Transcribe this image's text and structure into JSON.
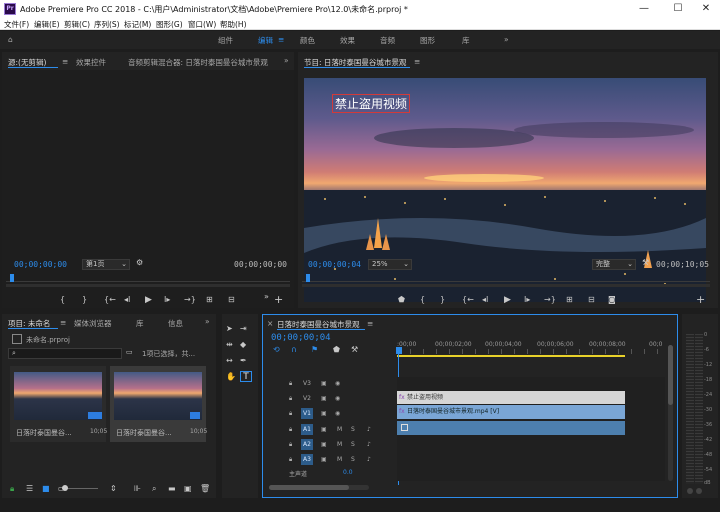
{
  "app": {
    "window_title": "Adobe Premiere Pro CC 2018 - C:\\用户\\Administrator\\文档\\Adobe\\Premiere Pro\\12.0\\未命名.prproj *",
    "logo_text": "Pr",
    "win_minimize": "—",
    "win_maximize": "☐",
    "win_close": "✕"
  },
  "menu": [
    "文件(F)",
    "编辑(E)",
    "剪辑(C)",
    "序列(S)",
    "标记(M)",
    "图形(G)",
    "窗口(W)",
    "帮助(H)"
  ],
  "workspace": {
    "tabs": [
      "组件",
      "编辑",
      "颜色",
      "效果",
      "音频",
      "图形",
      "库"
    ],
    "active": "编辑",
    "menu_glyph": "≡",
    "more_glyph": "»"
  },
  "source_panel": {
    "tabs": [
      "源:(无剪辑)",
      "效果控件",
      "音频剪辑混合器: 日落时泰国曼谷城市景观"
    ],
    "timecode_left": "00;00;00;00",
    "page_select": "第1页",
    "timecode_right": "00;00;00;00"
  },
  "program_panel": {
    "title": "节目: 日落时泰国曼谷城市景观",
    "watermark": "禁止盗用视频",
    "timecode_left": "00;00;00;04",
    "zoom": "25%",
    "quality": "完整",
    "timecode_right": "00;00;10;05"
  },
  "project_panel": {
    "tabs": [
      "项目: 未命名",
      "媒体浏览器",
      "库",
      "信息"
    ],
    "project_file": "未命名.prproj",
    "selection_info": "1项已选择，共...",
    "items": [
      {
        "name": "日落时泰国曼谷...",
        "duration": "10;05"
      },
      {
        "name": "日落时泰国曼谷...",
        "duration": "10;05"
      }
    ]
  },
  "timeline_panel": {
    "title": "日落时泰国曼谷城市景观",
    "timecode": "00;00;00;04",
    "ruler": [
      ":00;00",
      "00;00;02;00",
      "00;00;04;00",
      "00;00;06;00",
      "00;00;08;00",
      "00;0"
    ],
    "tracks_video": [
      "V3",
      "V2",
      "V1"
    ],
    "tracks_audio": [
      "A1",
      "A2",
      "A3"
    ],
    "master_label": "主声道",
    "master_value": "0.0",
    "clip_title": "禁止盗用视频",
    "clip_video": "日落时泰国曼谷城市景观.mp4 [V]",
    "meter_scale": [
      "0",
      "-6",
      "-12",
      "-18",
      "-24",
      "-30",
      "-36",
      "-42",
      "-48",
      "-54"
    ],
    "meter_unit": "dB"
  },
  "colors": {
    "accent": "#2d8ceb",
    "panel": "#232323",
    "bg": "#1d1d1d",
    "clip_video": "#7aa6d6",
    "clip_graphic": "#d6d6d6",
    "clip_audio": "#4d7fae"
  }
}
